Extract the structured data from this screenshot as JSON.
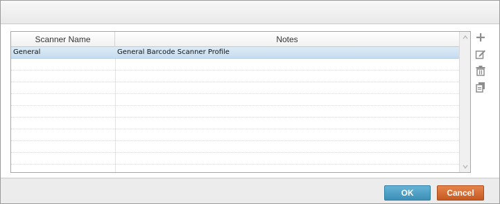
{
  "dialog": {
    "title": ""
  },
  "grid": {
    "columns": [
      {
        "label": "Scanner Name"
      },
      {
        "label": "Notes"
      }
    ],
    "rows": [
      {
        "name": "General",
        "notes": "General Barcode Scanner Profile",
        "selected": true
      },
      {
        "name": "",
        "notes": ""
      },
      {
        "name": "",
        "notes": ""
      },
      {
        "name": "",
        "notes": ""
      },
      {
        "name": "",
        "notes": ""
      },
      {
        "name": "",
        "notes": ""
      },
      {
        "name": "",
        "notes": ""
      },
      {
        "name": "",
        "notes": ""
      },
      {
        "name": "",
        "notes": ""
      },
      {
        "name": "",
        "notes": ""
      },
      {
        "name": "",
        "notes": ""
      }
    ]
  },
  "toolbar": {
    "icons": [
      "add-icon",
      "edit-icon",
      "delete-icon",
      "copy-icon"
    ]
  },
  "footer": {
    "ok_label": "OK",
    "cancel_label": "Cancel"
  },
  "colors": {
    "ok": "#3d8fb8",
    "cancel": "#c45a22",
    "selection": "#c6ddef"
  }
}
